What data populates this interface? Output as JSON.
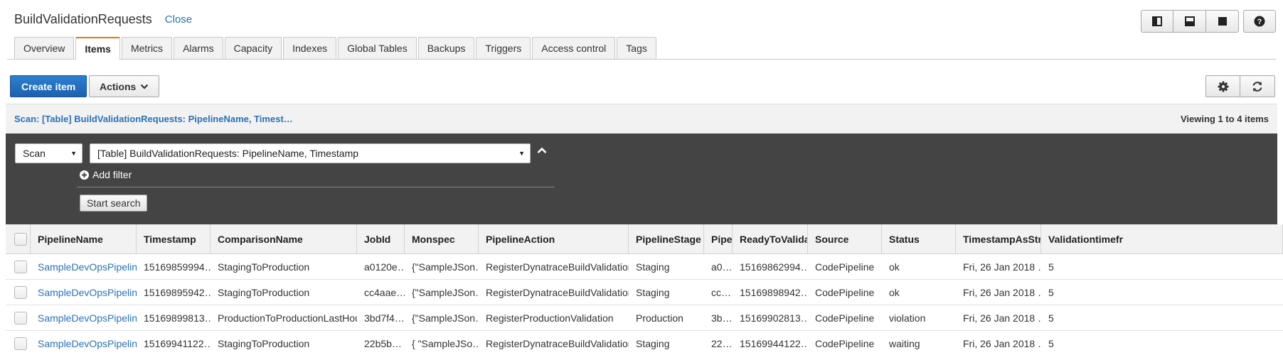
{
  "header": {
    "title": "BuildValidationRequests",
    "close_label": "Close"
  },
  "tabs": [
    "Overview",
    "Items",
    "Metrics",
    "Alarms",
    "Capacity",
    "Indexes",
    "Global Tables",
    "Backups",
    "Triggers",
    "Access control",
    "Tags"
  ],
  "active_tab": "Items",
  "toolbar": {
    "create_label": "Create item",
    "actions_label": "Actions"
  },
  "scan_bar": {
    "summary": "Scan: [Table] BuildValidationRequests: PipelineName, Timest…",
    "viewing": "Viewing 1 to 4 items"
  },
  "filter": {
    "operation": "Scan",
    "target": "[Table] BuildValidationRequests: PipelineName, Timestamp",
    "add_filter_label": "Add filter",
    "start_label": "Start search"
  },
  "table": {
    "columns": [
      "PipelineName",
      "Timestamp",
      "ComparisonName",
      "JobId",
      "Monspec",
      "PipelineAction",
      "PipelineStage",
      "Pipeli",
      "ReadyToValidateT",
      "Source",
      "Status",
      "TimestampAsString",
      "Validationtimefr"
    ],
    "rows": [
      [
        "SampleDevOpsPipeline",
        "15169859994…",
        "StagingToProduction",
        "a0120e…",
        "{\"SampleJSon…",
        "RegisterDynatraceBuildValidation",
        "Staging",
        "a0…",
        "15169862994…",
        "CodePipeline",
        "ok",
        "Fri, 26 Jan 2018 …",
        "5"
      ],
      [
        "SampleDevOpsPipeline",
        "15169895942…",
        "StagingToProduction",
        "cc4aae…",
        "{\"SampleJSon…",
        "RegisterDynatraceBuildValidation",
        "Staging",
        "cc…",
        "15169898942…",
        "CodePipeline",
        "ok",
        "Fri, 26 Jan 2018 …",
        "5"
      ],
      [
        "SampleDevOpsPipeline",
        "15169899813…",
        "ProductionToProductionLastHour",
        "3bd7f4…",
        "{\"SampleJSon…",
        "RegisterProductionValidation",
        "Production",
        "3b…",
        "15169902813…",
        "CodePipeline",
        "violation",
        "Fri, 26 Jan 2018 …",
        "5"
      ],
      [
        "SampleDevOpsPipeline",
        "15169941122…",
        "StagingToProduction",
        "22b5b…",
        "{ \"SampleJSo…",
        "RegisterDynatraceBuildValidation",
        "Staging",
        "22…",
        "15169944122…",
        "CodePipeline",
        "waiting",
        "Fri, 26 Jan 2018 …",
        "5"
      ]
    ]
  },
  "icons": {
    "view_toggles": [
      "layout-split-vertical-icon",
      "layout-split-horizontal-icon",
      "layout-full-icon"
    ],
    "help": "help-icon",
    "settings": "gear-icon",
    "refresh": "refresh-icon",
    "add_filter": "plus-circle-icon",
    "collapse": "chevron-up-icon"
  },
  "colors": {
    "primary_button": "#1f6bbf",
    "link": "#2a72b8",
    "filter_panel": "#444444",
    "active_tab_accent": "#e07b00"
  }
}
